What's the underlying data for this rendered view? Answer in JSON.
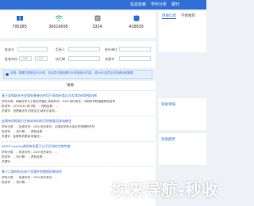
{
  "header": {
    "nav": [
      "信息检索",
      "学科分析",
      "期刊"
    ]
  },
  "stats": [
    {
      "icon": "book-icon",
      "value": "795385",
      "label": "",
      "color": "#2f6fd6"
    },
    {
      "icon": "wifi-icon",
      "value": "36616695",
      "label": "",
      "color": "#16a6a0"
    },
    {
      "icon": "badge-icon",
      "value": "3324",
      "label": "",
      "color": "#7f8c9b"
    },
    {
      "icon": "db-icon",
      "value": "418839",
      "label": "",
      "color": "#2f6fd6"
    }
  ],
  "form": {
    "labels": [
      "批准号",
      "负责人",
      "批准年份",
      "1999",
      "2021",
      "执行期",
      "依托单位",
      "关键字"
    ],
    "buttons": [
      "检索"
    ]
  },
  "notice": "说明：数据已更新至2020年，非会员只能查看2020年度部分内容，成为VIP会员后可查看全部数据",
  "list_header": "项目",
  "items": [
    {
      "title": "基于双相纳米合金相铂基催化剂用于高效析氢反应及其协同增强机制",
      "rows": [
        "学科分类：纳微化学与工程化学催化   批准年份：2020   依托单位：中国科学院福建物质结构",
        "批准号：21975245   执行期：...   资助经费：... ",
        "关键字：铂基催化剂;析氢反应;纳米合金相;..."
      ]
    },
    {
      "title": "金属有机框架衍生纳米材料的可控制备及其电催化",
      "rows": [
        "学科分类：...   批准年份：2020   依托单位：中国科学院大连化学物理研究所",
        "批准号：...   执行期：...   资助经费：...",
        "关键字：金属有机框架;电催化;..."
      ]
    },
    {
      "title": "NDRP-Cas12a调控体系基于分子识别的生物传感",
      "rows": [
        "学科分类：...   批准年份：2020   依托单位：...",
        "批准号：...   执行期：...   资助经费：...",
        "关键字：..."
      ]
    },
    {
      "title": "基于二维材料光电子学器件的物理机制研究",
      "rows": [
        "学科分类：...   批准年份：2020   依托单位：...",
        "批准号：...   执行期：..."
      ]
    }
  ],
  "side": {
    "tabs": [
      "项目信息",
      "学者推荐"
    ],
    "panels": [
      "资助领域",
      "资助趋势"
    ]
  },
  "watermark": "坎来导航-秒收"
}
